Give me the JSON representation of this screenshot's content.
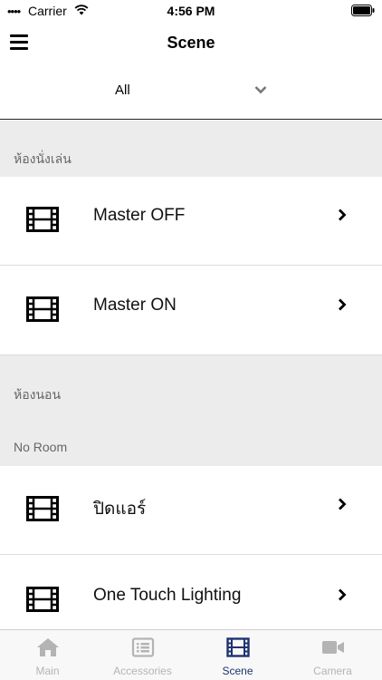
{
  "status_bar": {
    "signal": "••••",
    "carrier": "Carrier",
    "time": "4:56 PM"
  },
  "nav": {
    "title": "Scene"
  },
  "filter": {
    "selected": "All"
  },
  "sections": [
    {
      "title": "ห้องนั่งเล่น",
      "scenes": [
        {
          "label": "Master OFF",
          "icon": "film-icon"
        },
        {
          "label": "Master ON",
          "icon": "film-icon"
        }
      ]
    },
    {
      "title": "ห้องนอน",
      "scenes": []
    },
    {
      "title": "No Room",
      "scenes": [
        {
          "label": "ปิดแอร์",
          "icon": "film-icon"
        },
        {
          "label": "One Touch Lighting",
          "icon": "film-icon"
        }
      ]
    }
  ],
  "tabs": [
    {
      "label": "Main",
      "icon": "home-icon",
      "active": false
    },
    {
      "label": "Accessories",
      "icon": "list-icon",
      "active": false
    },
    {
      "label": "Scene",
      "icon": "film-icon",
      "active": true
    },
    {
      "label": "Camera",
      "icon": "camera-icon",
      "active": false
    }
  ],
  "colors": {
    "active_tab": "#1f3270",
    "inactive_tab": "#b4b4b4",
    "section_bg": "#ececec",
    "section_text": "#666666"
  }
}
